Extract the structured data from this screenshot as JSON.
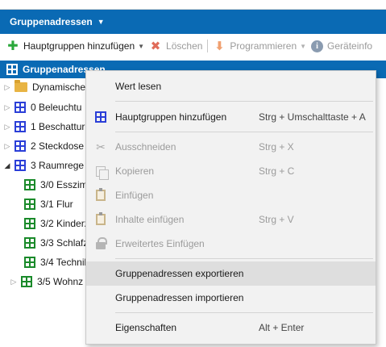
{
  "panel": {
    "title": "Gruppenadressen"
  },
  "toolbar": {
    "add_main_groups": "Hauptgruppen hinzufügen",
    "delete": "Löschen",
    "program": "Programmieren",
    "device_info": "Geräteinfo"
  },
  "tree": {
    "root": "Gruppenadressen",
    "items": [
      {
        "label": "Dynamische"
      },
      {
        "label": "0 Beleuchtu"
      },
      {
        "label": "1 Beschattur"
      },
      {
        "label": "2 Steckdose"
      },
      {
        "label": "3 Raumrege"
      },
      {
        "label": "3/0 Esszim"
      },
      {
        "label": "3/1 Flur"
      },
      {
        "label": "3/2 Kinderz"
      },
      {
        "label": "3/3 Schlafz"
      },
      {
        "label": "3/4 Technik"
      },
      {
        "label": "3/5 Wohnz"
      }
    ]
  },
  "context_menu": {
    "items": [
      {
        "label": "Wert lesen",
        "shortcut": ""
      },
      {
        "label": "Hauptgruppen hinzufügen",
        "shortcut": "Strg + Umschalttaste + A"
      },
      {
        "label": "Ausschneiden",
        "shortcut": "Strg + X"
      },
      {
        "label": "Kopieren",
        "shortcut": "Strg + C"
      },
      {
        "label": "Einfügen",
        "shortcut": ""
      },
      {
        "label": "Inhalte einfügen",
        "shortcut": "Strg + V"
      },
      {
        "label": "Erweitertes Einfügen",
        "shortcut": ""
      },
      {
        "label": "Gruppenadressen exportieren",
        "shortcut": ""
      },
      {
        "label": "Gruppenadressen importieren",
        "shortcut": ""
      },
      {
        "label": "Eigenschaften",
        "shortcut": "Alt + Enter"
      }
    ]
  },
  "colors": {
    "accent": "#0a6ab4",
    "group_icon_blue": "#2b3fd8",
    "group_icon_green": "#1a8a2a",
    "menu_bg": "#f2f2f2",
    "menu_hover": "#dedede"
  },
  "icons": {
    "add": "plus-icon",
    "delete": "x-icon",
    "program": "download-arrow-icon",
    "info": "info-icon",
    "group_address": "group-address-icon",
    "folder": "folder-icon",
    "cut": "scissors-icon",
    "copy": "copy-icon",
    "paste": "clipboard-icon",
    "extended_paste": "lock-icon"
  }
}
